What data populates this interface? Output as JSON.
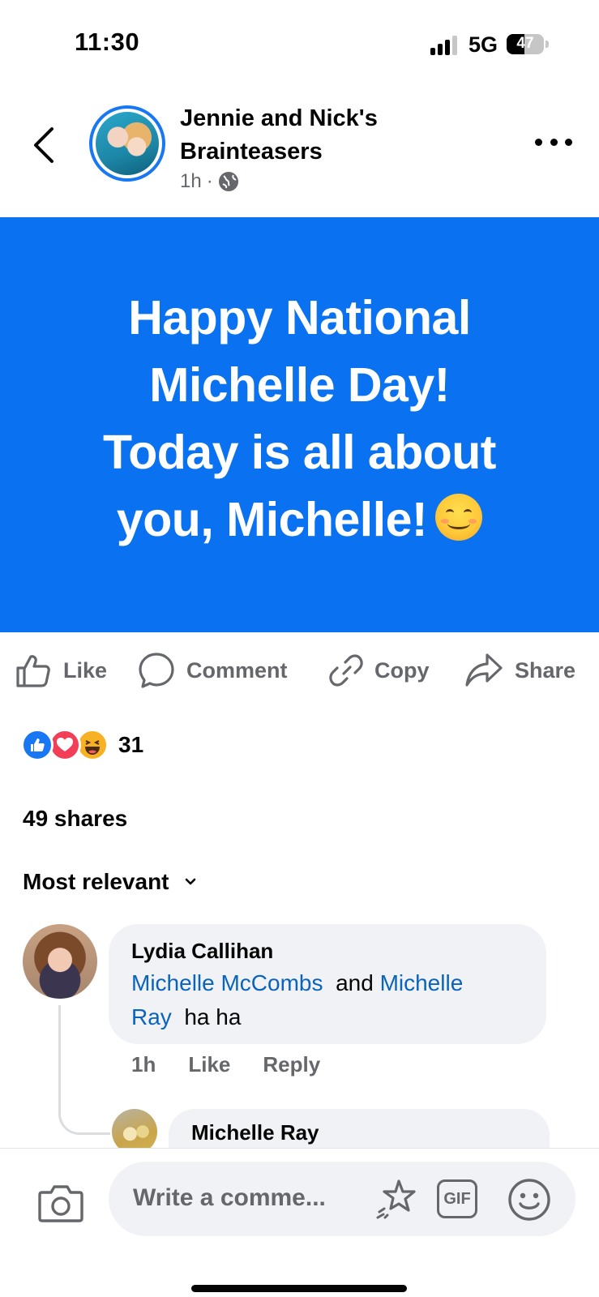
{
  "status_bar": {
    "time": "11:30",
    "network": "5G",
    "battery": "47"
  },
  "header": {
    "page_name": "Jennie and Nick's Brainteasers",
    "time_ago": "1h",
    "separator": "·",
    "privacy_icon": "globe-icon"
  },
  "post": {
    "background_color": "#0a72f0",
    "text_line_1": "Happy National",
    "text_line_2": "Michelle Day!",
    "text_line_3": "Today is all about",
    "text_line_4": "you, Michelle!",
    "emoji": "smiling-face-emoji"
  },
  "actions": {
    "like": "Like",
    "comment": "Comment",
    "copy": "Copy",
    "share": "Share"
  },
  "reactions": {
    "types": [
      "like",
      "love",
      "haha"
    ],
    "count": "31"
  },
  "shares": "49 shares",
  "sort": {
    "label": "Most relevant"
  },
  "comments": [
    {
      "author": "Lydia Callihan",
      "mention_1": "Michelle McCombs",
      "connector": "and",
      "mention_2a": "Michelle",
      "mention_2b": "Ray",
      "text": "ha ha",
      "time": "1h",
      "like": "Like",
      "reply": "Reply",
      "replies": [
        {
          "author": "Michelle Ray"
        }
      ]
    }
  ],
  "composer": {
    "placeholder": "Write a comme...",
    "gif": "GIF"
  },
  "colors": {
    "accent": "#1877f2",
    "mention": "#0a64bc",
    "muted": "#65676b",
    "bubble": "#f0f2f5"
  }
}
